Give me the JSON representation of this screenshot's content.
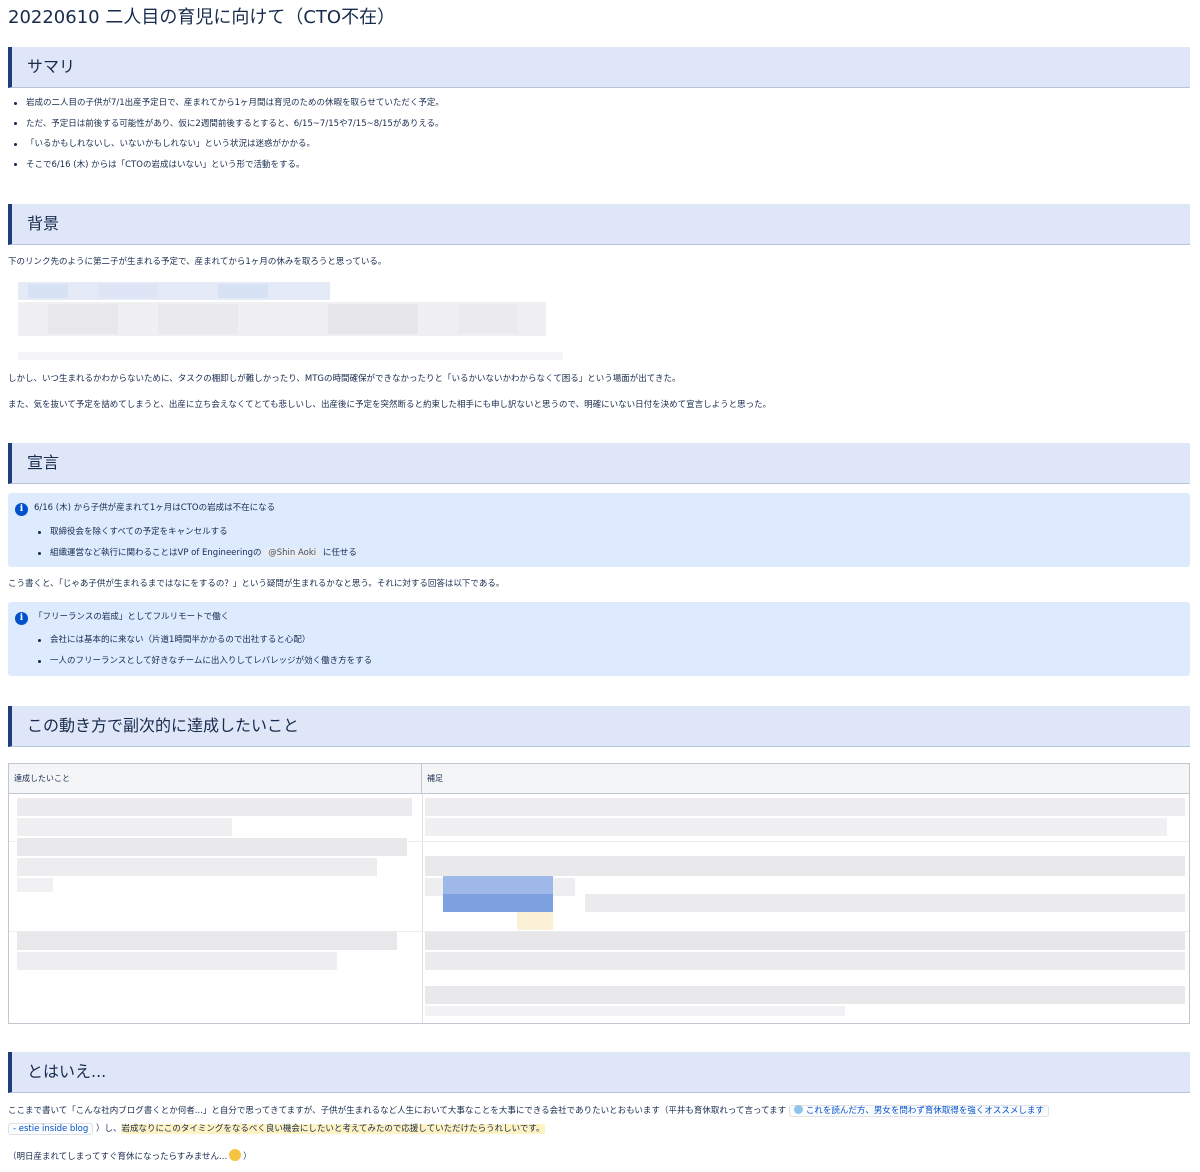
{
  "page_title": "20220610 二人目の育児に向けて（CTO不在）",
  "sections": {
    "summary": {
      "heading": "サマリ",
      "bullets": [
        "岩成の二人目の子供が7/1出産予定日で、産まれてから1ヶ月間は育児のための休暇を取らせていただく予定。",
        "ただ、予定日は前後する可能性があり、仮に2週間前後するとすると、6/15~7/15や7/15~8/15がありえる。",
        "「いるかもしれないし、いないかもしれない」という状況は迷惑がかかる。",
        "そこで6/16 (木) からは「CTOの岩成はいない」という形で活動をする。"
      ]
    },
    "background": {
      "heading": "背景",
      "para1": "下のリンク先のように第二子が生まれる予定で、産まれてから1ヶ月の休みを取ろうと思っている。",
      "para2": "しかし、いつ生まれるかわからないために、タスクの棚卸しが難しかったり、MTGの時間確保ができなかったりと「いるかいないかわからなくて困る」という場面が出てきた。",
      "para3": "また、気を抜いて予定を詰めてしまうと、出産に立ち会えなくてとても悲しいし、出産後に予定を突然断ると約束した相手にも申し訳ないと思うので、明確にいない日付を決めて宣言しようと思った。"
    },
    "declaration": {
      "heading": "宣言",
      "panel1": {
        "title": "6/16 (木) から子供が産まれて1ヶ月はCTOの岩成は不在になる",
        "item1": "取締役会を除くすべての予定をキャンセルする",
        "item2_prefix": "組織運営など執行に関わることはVP of Engineeringの ",
        "item2_mention": "@Shin Aoki",
        "item2_suffix": " に任せる"
      },
      "between": "こう書くと、「じゃあ子供が生まれるまではなにをするの？」という疑問が生まれるかなと思う。それに対する回答は以下である。",
      "panel2": {
        "title": "「フリーランスの岩成」としてフルリモートで働く",
        "item1": "会社には基本的に来ない（片道1時間半かかるので出社すると心配）",
        "item2": "一人のフリーランスとして好きなチームに出入りしてレバレッジが効く働き方をする"
      }
    },
    "goals": {
      "heading": "この動き方で副次的に達成したいこと",
      "col1": "達成したいこと",
      "col2": "補足"
    },
    "however": {
      "heading": "とはいえ...",
      "line1_prefix": "ここまで書いて「こんな社内ブログ書くとか何者...」と自分で思ってきてますが、子供が生まれるなど人生において大事なことを大事にできる会社でありたいとおもいます（平井も育休取れって言ってます ",
      "line1_link": "これを読んだ方、男女を問わず育休取得を強くオススメします",
      "line2_link": "- estie inside blog",
      "line2_mid": " ）し、",
      "line2_highlight": "岩成なりにこのタイミングをなるべく良い機会にしたいと考えてみたので応援していただけたらうれしいです。",
      "line3_prefix": "（明日産まれてしまってすぐ育休になったらすみません...",
      "line3_suffix": "）"
    }
  },
  "colors": {
    "header_bg": "#dfe6f8",
    "header_border": "#1f3f7a",
    "info_bg": "#deebff",
    "info_icon": "#0052cc",
    "link": "#0052cc",
    "highlight": "#fff3c4"
  },
  "icons": {
    "info": "info-circle-icon",
    "blog": "blog-favicon-icon",
    "emoji": "sweat-smile-emoji-icon"
  }
}
